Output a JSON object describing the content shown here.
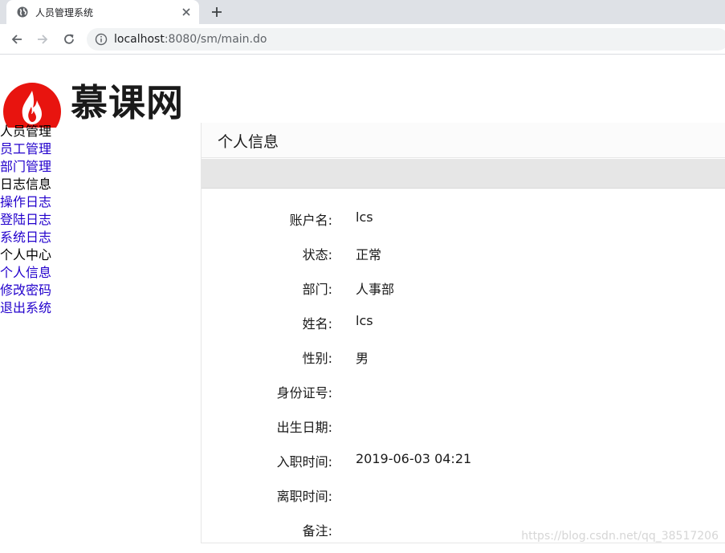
{
  "browser": {
    "tab_title": "人员管理系统",
    "url_host": "localhost",
    "url_rest": ":8080/sm/main.do"
  },
  "logo": {
    "text": "慕课网",
    "icon": "flame-icon",
    "color": "#e8140f"
  },
  "sidebar": {
    "sections": [
      {
        "title": "人员管理",
        "items": [
          "员工管理",
          "部门管理"
        ]
      },
      {
        "title": "日志信息",
        "items": [
          "操作日志",
          "登陆日志",
          "系统日志"
        ]
      },
      {
        "title": "个人中心",
        "items": [
          "个人信息",
          "修改密码",
          "退出系统"
        ]
      }
    ]
  },
  "panel": {
    "title": "个人信息",
    "fields": [
      {
        "label": "账户名:",
        "value": "lcs"
      },
      {
        "label": "状态:",
        "value": "正常"
      },
      {
        "label": "部门:",
        "value": "人事部"
      },
      {
        "label": "姓名:",
        "value": "lcs"
      },
      {
        "label": "性别:",
        "value": "男"
      },
      {
        "label": "身份证号:",
        "value": ""
      },
      {
        "label": "出生日期:",
        "value": ""
      },
      {
        "label": "入职时间:",
        "value": "2019-06-03 04:21"
      },
      {
        "label": "离职时间:",
        "value": ""
      },
      {
        "label": "备注:",
        "value": ""
      }
    ]
  },
  "watermark": "https://blog.csdn.net/qq_38517206"
}
